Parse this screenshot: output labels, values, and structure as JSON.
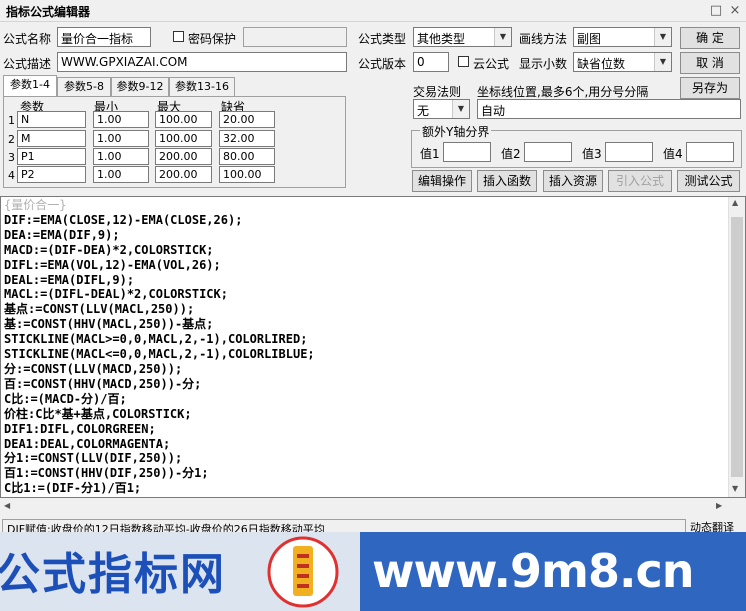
{
  "window": {
    "title": "指标公式编辑器",
    "restore_icon": "□",
    "close_icon": "×"
  },
  "form": {
    "name_label": "公式名称",
    "name_value": "量价合一指标",
    "password_label": "密码保护",
    "desc_label": "公式描述",
    "desc_value": "WWW.GPXIAZAI.COM",
    "type_label": "公式类型",
    "type_value": "其他类型",
    "draw_label": "画线方法",
    "draw_value": "副图",
    "version_label": "公式版本",
    "version_value": "0",
    "cloud_label": "云公式",
    "decimals_label": "显示小数",
    "decimals_value": "缺省位数"
  },
  "buttons": {
    "ok": "确  定",
    "cancel": "取  消",
    "save_as": "另存为",
    "edit_ops": "编辑操作",
    "insert_func": "插入函数",
    "insert_res": "插入资源",
    "import_formula": "引入公式",
    "test_formula": "测试公式"
  },
  "params": {
    "tabs": [
      "参数1-4",
      "参数5-8",
      "参数9-12",
      "参数13-16"
    ],
    "headers": [
      "参数",
      "最小",
      "最大",
      "缺省"
    ],
    "rows": [
      {
        "n": "1",
        "name": "N",
        "min": "1.00",
        "max": "100.00",
        "def": "20.00"
      },
      {
        "n": "2",
        "name": "M",
        "min": "1.00",
        "max": "100.00",
        "def": "32.00"
      },
      {
        "n": "3",
        "name": "P1",
        "min": "1.00",
        "max": "200.00",
        "def": "80.00"
      },
      {
        "n": "4",
        "name": "P2",
        "min": "1.00",
        "max": "200.00",
        "def": "100.00"
      }
    ]
  },
  "trade": {
    "rule_label": "交易法则",
    "rule_value": "无",
    "coord_label": "坐标线位置,最多6个,用分号分隔",
    "coord_value": "自动",
    "yaxis_label": "额外Y轴分界",
    "val_labels": [
      "值1",
      "值2",
      "值3",
      "值4"
    ]
  },
  "code_lines": [
    "{量价合一}",
    "DIF:=EMA(CLOSE,12)-EMA(CLOSE,26);",
    "DEA:=EMA(DIF,9);",
    "MACD:=(DIF-DEA)*2,COLORSTICK;",
    "DIFL:=EMA(VOL,12)-EMA(VOL,26);",
    "DEAL:=EMA(DIFL,9);",
    "MACL:=(DIFL-DEAL)*2,COLORSTICK;",
    "基点:=CONST(LLV(MACL,250));",
    "基:=CONST(HHV(MACL,250))-基点;",
    "STICKLINE(MACL>=0,0,MACL,2,-1),COLORLIRED;",
    "STICKLINE(MACL<=0,0,MACL,2,-1),COLORLIBLUE;",
    "分:=CONST(LLV(MACD,250));",
    "百:=CONST(HHV(MACD,250))-分;",
    "C比:=(MACD-分)/百;",
    "价柱:C比*基+基点,COLORSTICK;",
    "DIF1:DIFL,COLORGREEN;",
    "DEA1:DEAL,COLORMAGENTA;",
    "分1:=CONST(LLV(DIF,250));",
    "百1:=CONST(HHV(DIF,250))-分1;",
    "C比1:=(DIF-分1)/百1;"
  ],
  "status": {
    "text": "DIF赋值:收盘价的12日指数移动平均-收盘价的26日指数移动平均",
    "right": "动态翻译"
  },
  "banner": {
    "left_text": "公式指标网",
    "right_text": "www.9m8.cn",
    "logo_text": "www.9m8.cn"
  }
}
